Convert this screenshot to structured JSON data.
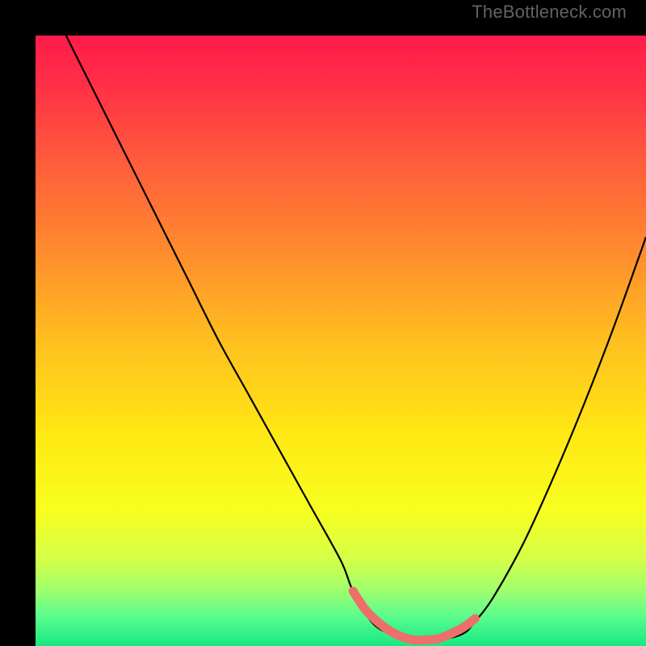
{
  "watermark": "TheBottleneck.com",
  "chart_data": {
    "type": "line",
    "title": "",
    "xlabel": "",
    "ylabel": "",
    "xlim": [
      0,
      100
    ],
    "ylim": [
      0,
      100
    ],
    "series": [
      {
        "name": "curve",
        "color": "#000000",
        "x": [
          5,
          10,
          15,
          20,
          25,
          30,
          35,
          40,
          45,
          50,
          52,
          55,
          58,
          62,
          66,
          70,
          72,
          75,
          80,
          85,
          90,
          95,
          100
        ],
        "y": [
          100,
          90,
          80,
          70,
          60,
          50,
          41,
          32,
          23,
          14,
          9,
          4,
          2,
          1,
          1,
          2,
          4,
          8,
          17,
          28,
          40,
          53,
          67
        ]
      },
      {
        "name": "low-segment",
        "color": "#ed6f69",
        "thick": true,
        "x": [
          52,
          54,
          56,
          58,
          60,
          62,
          64,
          66,
          68,
          70,
          72
        ],
        "y": [
          9,
          6,
          4,
          2.5,
          1.5,
          1,
          1,
          1.2,
          2,
          3,
          4.5
        ]
      }
    ],
    "gradient_stops": [
      {
        "offset": 0.0,
        "color": "#ff1a4b"
      },
      {
        "offset": 0.08,
        "color": "#ff2f46"
      },
      {
        "offset": 0.2,
        "color": "#ff5a3c"
      },
      {
        "offset": 0.35,
        "color": "#ff8a2e"
      },
      {
        "offset": 0.5,
        "color": "#ffbf1f"
      },
      {
        "offset": 0.65,
        "color": "#ffe714"
      },
      {
        "offset": 0.78,
        "color": "#f7ff20"
      },
      {
        "offset": 0.86,
        "color": "#d2ff4a"
      },
      {
        "offset": 0.91,
        "color": "#9dff6e"
      },
      {
        "offset": 0.95,
        "color": "#5cfd8d"
      },
      {
        "offset": 1.0,
        "color": "#17e884"
      }
    ]
  }
}
